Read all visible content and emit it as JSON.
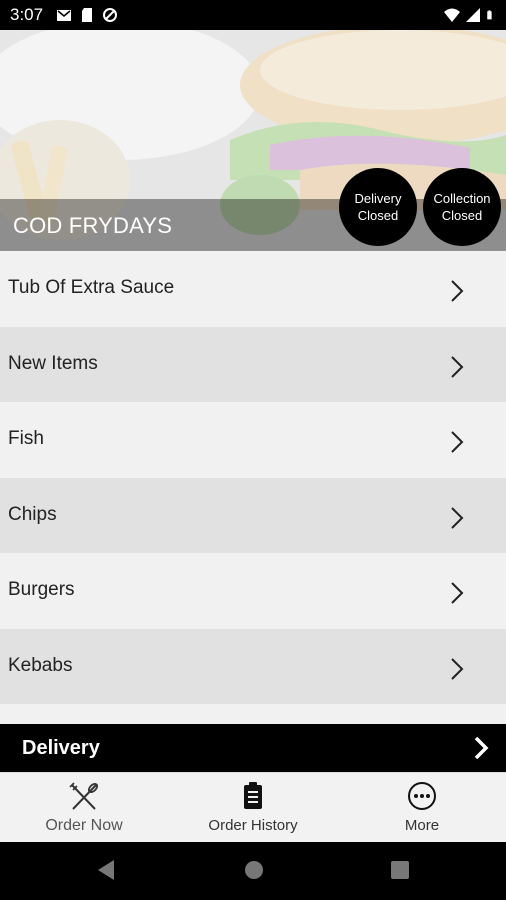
{
  "status_bar": {
    "time": "3:07",
    "left_icons": [
      "gmail-icon",
      "sd-card-icon",
      "data-saver-icon"
    ],
    "right_icons": [
      "wifi-icon",
      "signal-icon",
      "battery-icon"
    ]
  },
  "hero": {
    "title": "COD FRYDAYS",
    "badges": [
      {
        "line1": "Delivery",
        "line2": "Closed"
      },
      {
        "line1": "Collection",
        "line2": "Closed"
      }
    ]
  },
  "menu": {
    "items": [
      {
        "label": "Tub Of Extra Sauce"
      },
      {
        "label": "New Items"
      },
      {
        "label": "Fish"
      },
      {
        "label": "Chips"
      },
      {
        "label": "Burgers"
      },
      {
        "label": "Kebabs"
      }
    ]
  },
  "delivery_bar": {
    "label": "Delivery"
  },
  "tabbar": {
    "tabs": [
      {
        "label": "Order Now",
        "icon": "cutlery-icon"
      },
      {
        "label": "Order History",
        "icon": "clipboard-icon"
      },
      {
        "label": "More",
        "icon": "more-icon"
      }
    ]
  },
  "nav": {
    "buttons": [
      "back-icon",
      "home-icon",
      "recents-icon"
    ]
  },
  "colors": {
    "bar_black": "#000000",
    "row_light": "#f1f1f1",
    "row_dark": "#e1e1e1"
  }
}
